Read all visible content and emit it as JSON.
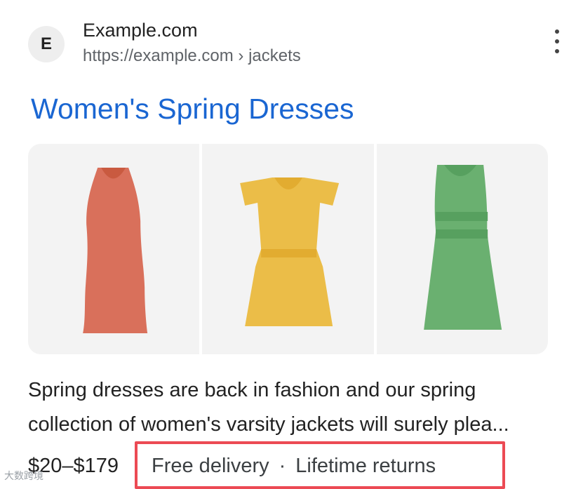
{
  "result": {
    "favicon_letter": "E",
    "site_name": "Example.com",
    "site_url": "https://example.com › jackets",
    "title": "Women's Spring Dresses",
    "images": [
      {
        "icon": "red-dress-icon",
        "color": "#d9705b"
      },
      {
        "icon": "yellow-dress-icon",
        "color": "#ebbd48"
      },
      {
        "icon": "green-dress-icon",
        "color": "#6ab070"
      }
    ],
    "snippet_lines": [
      "Spring dresses are back in fashion and our spring",
      "collection of women's varsity jackets will surely plea..."
    ],
    "price": "$20–$179",
    "features": [
      "Free delivery",
      "Lifetime returns"
    ],
    "separator": "·"
  },
  "colors": {
    "title_link": "#1a66d2",
    "highlight_box": "#ec4a54"
  },
  "watermark": "大数跨境"
}
